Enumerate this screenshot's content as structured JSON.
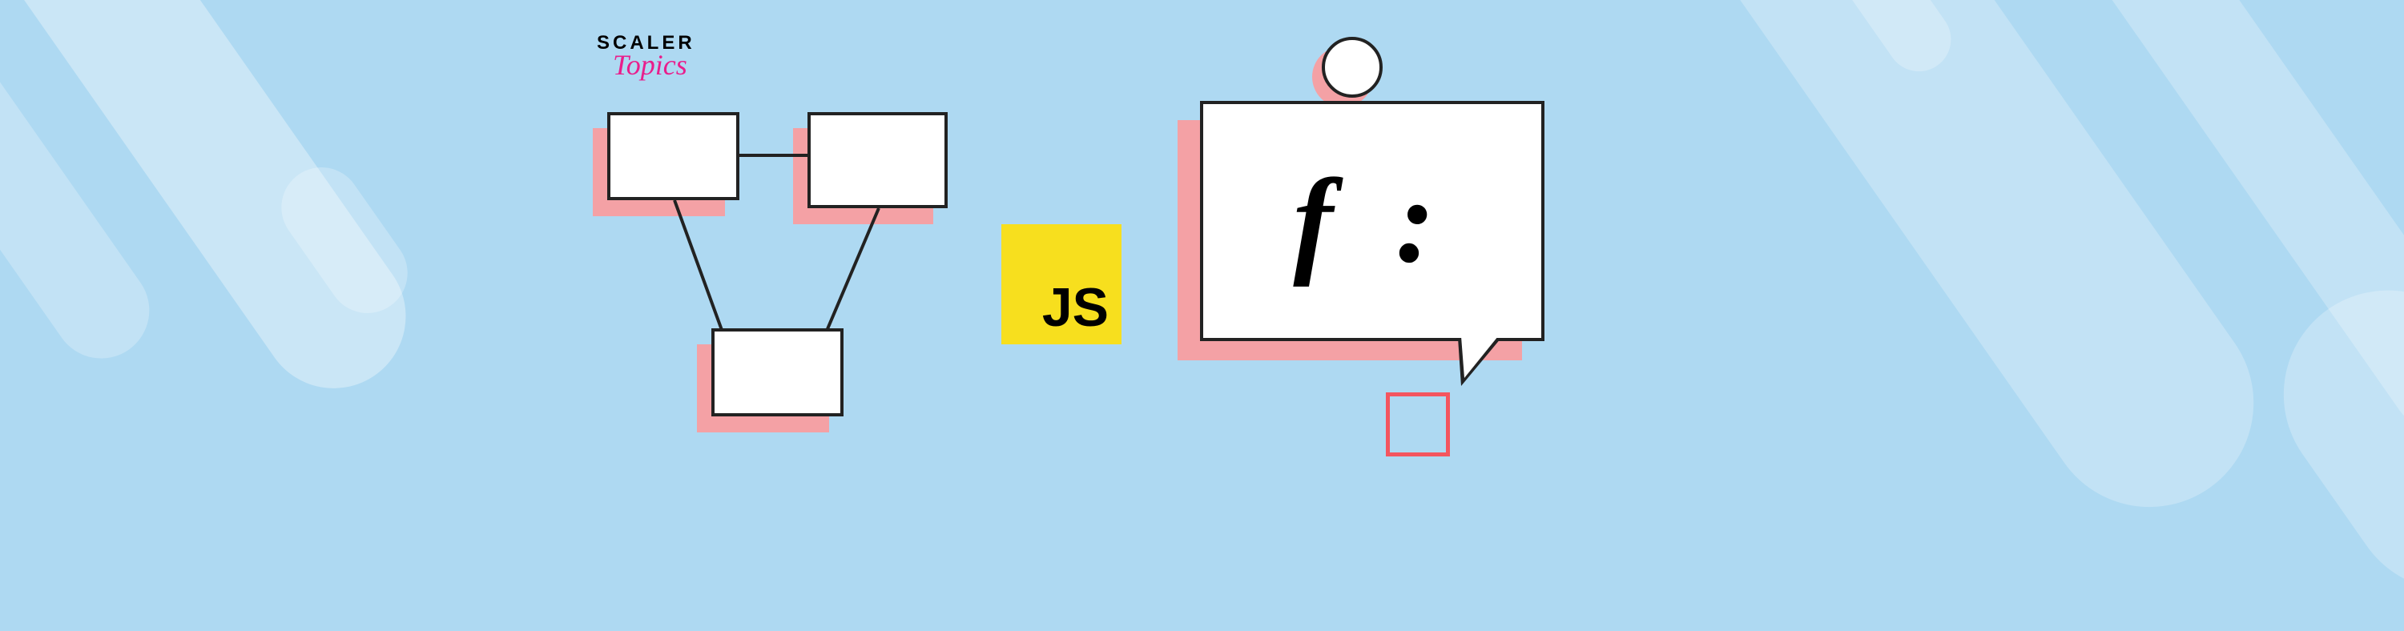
{
  "logo": {
    "brand": "SCALER",
    "sub": "Topics"
  },
  "js_badge": {
    "label": "JS"
  },
  "funcbox": {
    "label": "f :"
  }
}
